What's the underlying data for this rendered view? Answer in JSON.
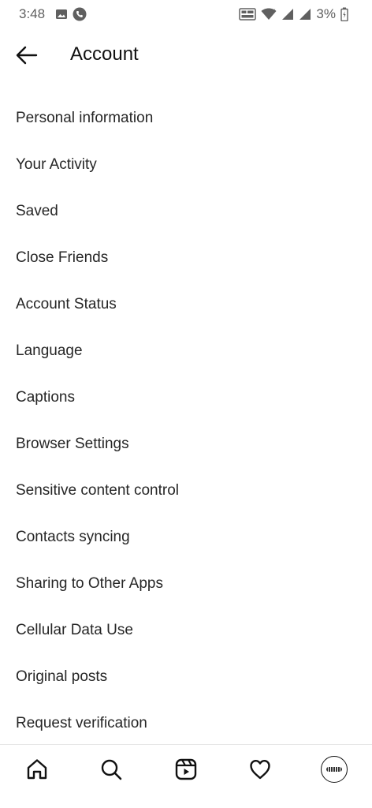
{
  "status_bar": {
    "time": "3:48",
    "battery": "3%",
    "icons": [
      "image-icon",
      "phone-call-icon",
      "volte-icon",
      "wifi-icon",
      "signal-icon",
      "signal-icon",
      "battery-icon"
    ]
  },
  "header": {
    "back_icon": "arrow-left-icon",
    "title": "Account"
  },
  "menu": {
    "items": [
      {
        "label": "Personal information"
      },
      {
        "label": "Your Activity"
      },
      {
        "label": "Saved"
      },
      {
        "label": "Close Friends"
      },
      {
        "label": "Account Status"
      },
      {
        "label": "Language"
      },
      {
        "label": "Captions"
      },
      {
        "label": "Browser Settings"
      },
      {
        "label": "Sensitive content control"
      },
      {
        "label": "Contacts syncing"
      },
      {
        "label": "Sharing to Other Apps"
      },
      {
        "label": "Cellular Data Use"
      },
      {
        "label": "Original posts"
      },
      {
        "label": "Request verification"
      }
    ]
  },
  "bottom_nav": {
    "items": [
      "home-icon",
      "search-icon",
      "reels-icon",
      "heart-icon",
      "profile-avatar"
    ]
  },
  "colors": {
    "text": "#262626",
    "title": "#111111",
    "status": "#606060",
    "divider": "#e6e6e6"
  }
}
